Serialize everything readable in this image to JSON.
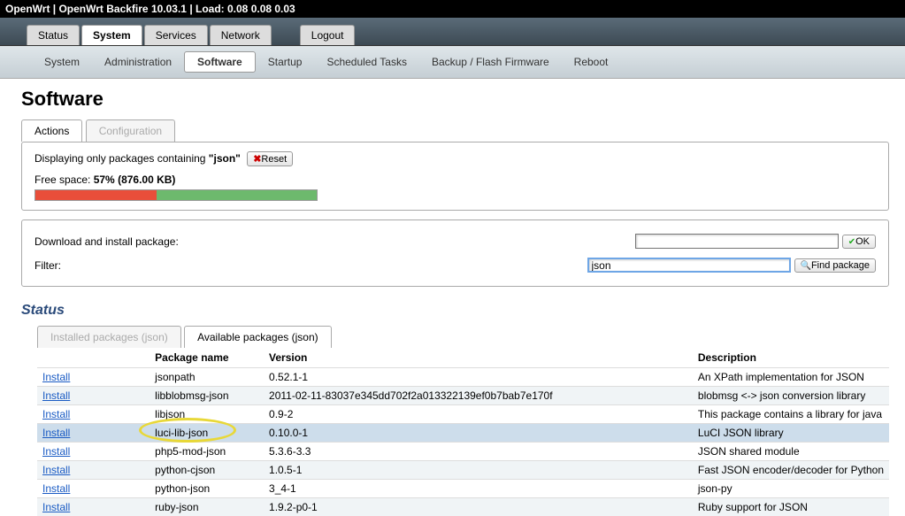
{
  "header": "OpenWrt | OpenWrt Backfire 10.03.1 | Load: 0.08 0.08 0.03",
  "top_tabs": [
    "Status",
    "System",
    "Services",
    "Network",
    "Logout"
  ],
  "top_active": 1,
  "sub_tabs": [
    "System",
    "Administration",
    "Software",
    "Startup",
    "Scheduled Tasks",
    "Backup / Flash Firmware",
    "Reboot"
  ],
  "sub_active": 2,
  "page_title": "Software",
  "action_tabs": {
    "actions": "Actions",
    "config": "Configuration"
  },
  "filter": {
    "prefix": "Displaying only packages containing ",
    "term": "\"json\"",
    "reset": "Reset"
  },
  "freespace": {
    "label_prefix": "Free space: ",
    "pct": "57%",
    "size": " (876.00 KB)",
    "used_pct": 43,
    "free_pct": 57
  },
  "form": {
    "download_label": "Download and install package:",
    "download_value": "",
    "ok": "OK",
    "filter_label": "Filter:",
    "filter_value": "json",
    "find": "Find package"
  },
  "status": {
    "title": "Status",
    "installed_tab": "Installed packages (json)",
    "available_tab": "Available packages (json)",
    "cols": {
      "name": "Package name",
      "version": "Version",
      "desc": "Description"
    },
    "install": "Install",
    "packages": [
      {
        "name": "jsonpath",
        "version": "0.52.1-1",
        "desc": "An XPath implementation for JSON"
      },
      {
        "name": "libblobmsg-json",
        "version": "2011-02-11-83037e345dd702f2a013322139ef0b7bab7e170f",
        "desc": "blobmsg <-> json conversion library"
      },
      {
        "name": "libjson",
        "version": "0.9-2",
        "desc": "This package contains a library for java"
      },
      {
        "name": "luci-lib-json",
        "version": "0.10.0-1",
        "desc": "LuCI JSON library"
      },
      {
        "name": "php5-mod-json",
        "version": "5.3.6-3.3",
        "desc": "JSON shared module"
      },
      {
        "name": "python-cjson",
        "version": "1.0.5-1",
        "desc": "Fast JSON encoder/decoder for Python"
      },
      {
        "name": "python-json",
        "version": "3_4-1",
        "desc": "json-py"
      },
      {
        "name": "ruby-json",
        "version": "1.9.2-p0-1",
        "desc": "Ruby support for JSON"
      }
    ],
    "highlight_row": 3
  }
}
